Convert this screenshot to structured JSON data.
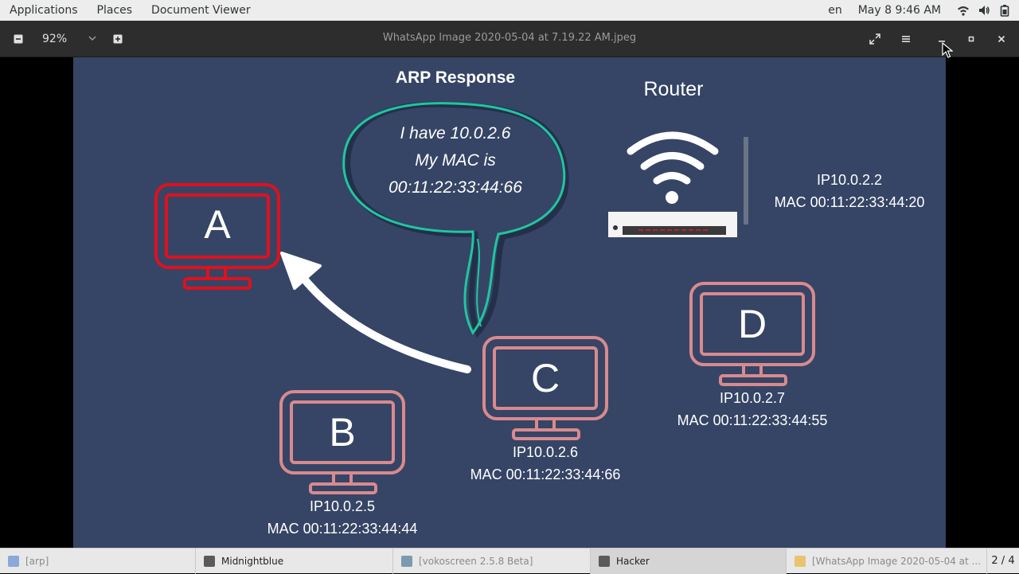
{
  "topbar": {
    "menus": [
      "Applications",
      "Places",
      "Document Viewer"
    ],
    "lang": "en",
    "clock": "May 8  9:46 AM"
  },
  "viewer": {
    "zoom": "92%",
    "title": "WhatsApp Image 2020-05-04 at 7.19.22 AM.jpeg"
  },
  "slide": {
    "bubble_title": "ARP Response",
    "bubble_lines": [
      "I have 10.0.2.6",
      "My MAC is",
      "00:11:22:33:44:66"
    ],
    "router_title": "Router",
    "router_ip": "IP10.0.2.2",
    "router_mac": "MAC 00:11:22:33:44:20",
    "nodes": {
      "a": {
        "letter": "A"
      },
      "b": {
        "letter": "B",
        "ip": "IP10.0.2.5",
        "mac": "MAC 00:11:22:33:44:44"
      },
      "c": {
        "letter": "C",
        "ip": "IP10.0.2.6",
        "mac": "MAC 00:11:22:33:44:66"
      },
      "d": {
        "letter": "D",
        "ip": "IP10.0.2.7",
        "mac": "MAC 00:11:22:33:44:55"
      }
    },
    "colors": {
      "background": "#364565",
      "victim": "#e0101e",
      "host": "#d98a8f",
      "bubble": "#1fc6a0"
    }
  },
  "taskbar": {
    "items": [
      "[arp]",
      "Midnightblue",
      "[vokoscreen 2.5.8 Beta]",
      "Hacker",
      "[WhatsApp Image 2020-05-04 at ..."
    ],
    "pager": "2 / 4"
  }
}
